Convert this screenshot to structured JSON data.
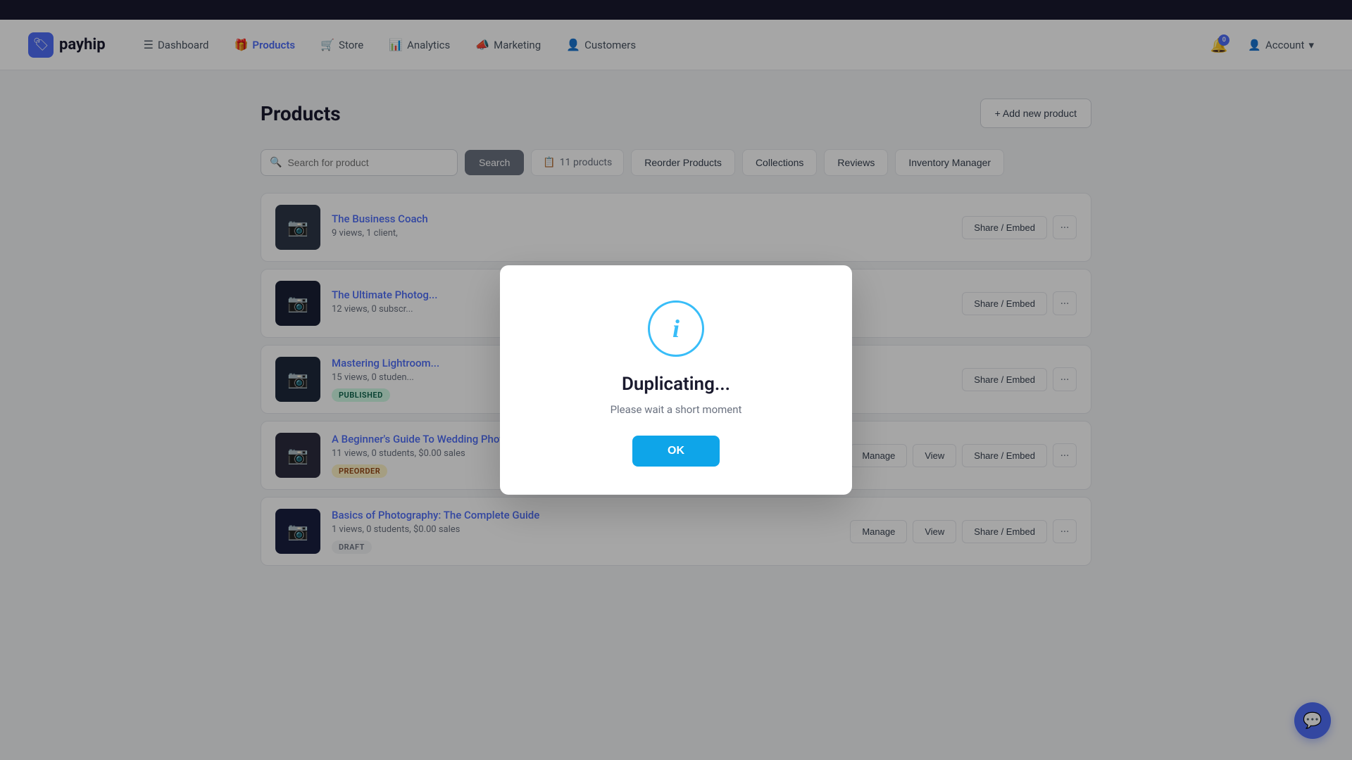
{
  "topbar": {},
  "nav": {
    "logo_text": "payhip",
    "logo_icon": "🏷",
    "items": [
      {
        "id": "dashboard",
        "label": "Dashboard",
        "icon": "☰",
        "active": false
      },
      {
        "id": "products",
        "label": "Products",
        "icon": "🎁",
        "active": true
      },
      {
        "id": "store",
        "label": "Store",
        "icon": "🛒",
        "active": false
      },
      {
        "id": "analytics",
        "label": "Analytics",
        "icon": "📊",
        "active": false
      },
      {
        "id": "marketing",
        "label": "Marketing",
        "icon": "📣",
        "active": false
      },
      {
        "id": "customers",
        "label": "Customers",
        "icon": "👤",
        "active": false
      }
    ],
    "bell_count": "0",
    "account_label": "Account"
  },
  "page": {
    "title": "Products",
    "add_button": "+ Add new product"
  },
  "toolbar": {
    "search_placeholder": "Search for product",
    "search_btn": "Search",
    "products_count": "11 products",
    "reorder_btn": "Reorder Products",
    "collections_btn": "Collections",
    "reviews_btn": "Reviews",
    "inventory_btn": "Inventory Manager"
  },
  "products": [
    {
      "id": 1,
      "name": "The Business Coach",
      "stats": "9 views,  1 client,",
      "badge": null,
      "badge_type": null,
      "actions": [
        "Share / Embed"
      ]
    },
    {
      "id": 2,
      "name": "The Ultimate Photog...",
      "stats": "12 views,  0 subscr...",
      "badge": null,
      "badge_type": null,
      "actions": [
        "Share / Embed"
      ]
    },
    {
      "id": 3,
      "name": "Mastering Lightroom...",
      "stats": "15 views,  0 studen...",
      "badge": "PUBLISHED",
      "badge_type": "published",
      "actions": [
        "Share / Embed"
      ]
    },
    {
      "id": 4,
      "name": "A Beginner's Guide To Wedding Photography",
      "stats": "11 views,  0 students,  $0.00 sales",
      "badge": "PREORDER",
      "badge_type": "preorder",
      "actions": [
        "Manage",
        "View",
        "Share / Embed"
      ]
    },
    {
      "id": 5,
      "name": "Basics of Photography: The Complete Guide",
      "stats": "1 views,  0 students,  $0.00 sales",
      "badge": "DRAFT",
      "badge_type": "draft",
      "actions": [
        "Manage",
        "View",
        "Share / Embed"
      ]
    }
  ],
  "modal": {
    "icon_char": "i",
    "title": "Duplicating...",
    "desc": "Please wait a short moment",
    "ok_btn": "OK"
  },
  "chat": {
    "icon": "💬"
  }
}
